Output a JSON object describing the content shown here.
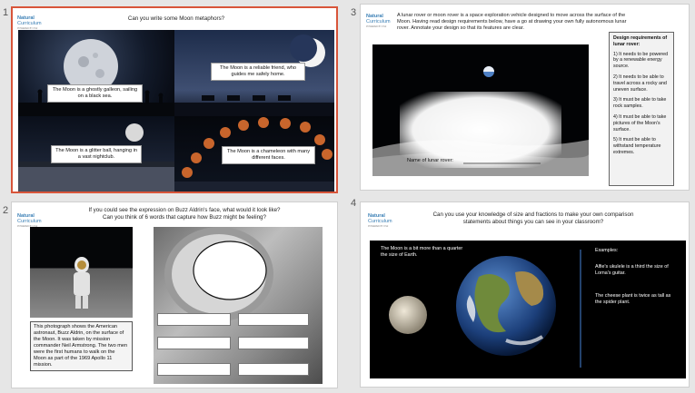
{
  "slides": [
    {
      "number": "1",
      "title": "Can you write some Moon metaphors?",
      "logo": {
        "line1": "Natural",
        "line2": "Curriculum",
        "tagline": "POWERED BY KS2"
      },
      "captions": [
        "The Moon is a ghostly galleon, sailing on a black sea.",
        "The Moon is a reliable friend, who guides me safely home.",
        "The Moon is a glitter ball, hanging in a vast nightclub.",
        "The Moon is a chameleon with many different faces."
      ]
    },
    {
      "number": "2",
      "title_line1": "If you could see the expression on Buzz Aldrin's face, what would it look like?",
      "title_line2": "Can you think of 6 words that capture how Buzz might be feeling?",
      "logo": {
        "line1": "Natural",
        "line2": "Curriculum",
        "tagline": "POWERED BY KS2"
      },
      "caption": "This photograph shows the American astronaut, Buzz Aldrin, on the surface of the Moon. It was taken by mission commander Neil Armstrong. The two men were the first humans to walk on the Moon as part of the 1969 Apollo 11 mission."
    },
    {
      "number": "3",
      "intro": "A lunar rover or moon rover is a space exploration vehicle designed to move across the surface of the Moon. Having read design requirements below, have a go at drawing your own fully autonomous lunar rover. Annotate your design so that its features are clear.",
      "logo": {
        "line1": "Natural",
        "line2": "Curriculum",
        "tagline": "POWERED BY KS2"
      },
      "rover_label": "Name of lunar rover:",
      "requirements_title": "Design requirements of lunar rover:",
      "requirements": [
        "1) It needs to be powered by a renewable energy source.",
        "2) It needs to be able to travel across a rocky and uneven surface.",
        "3) It must be able to take rock samples.",
        "4) It must be able to take pictures of the Moon's surface.",
        "5) It must be able to withstand temperature extremes."
      ]
    },
    {
      "number": "4",
      "title_line1": "Can you use your knowledge of size and  fractions to make your own comparison",
      "title_line2": "statements about things you can see in your classroom?",
      "logo": {
        "line1": "Natural",
        "line2": "Curriculum",
        "tagline": "POWERED BY KS2"
      },
      "moon_fact": "The Moon is a bit more than a quarter the size of Earth.",
      "examples_title": "Examples:",
      "examples": [
        "Alfie's ukulele is a third the size of Lorna's guitar.",
        "The cheese plant is twice as tall as the spider plant."
      ]
    }
  ]
}
